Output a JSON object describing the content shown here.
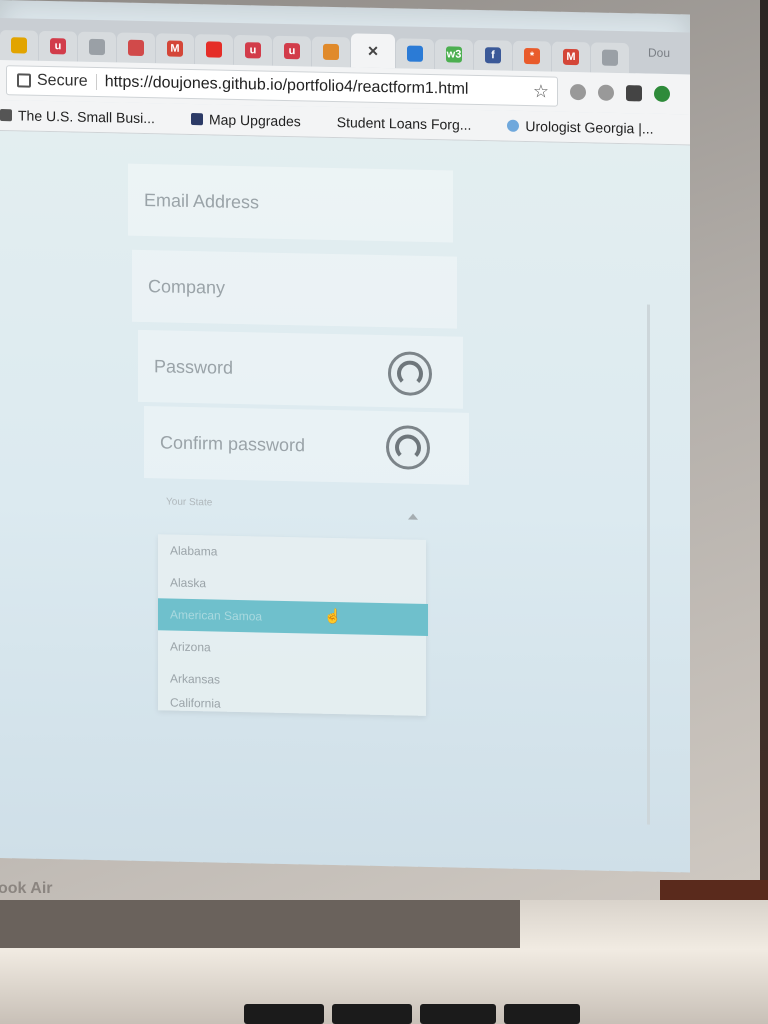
{
  "browser": {
    "tabs": [
      {
        "icon": "checkmark-favicon",
        "color": "#e2a400",
        "label": ""
      },
      {
        "icon": "u-favicon",
        "color": "#d23c4a",
        "label": "u"
      },
      {
        "icon": "document-favicon",
        "color": "#9aa0a6",
        "label": ""
      },
      {
        "icon": "photo-favicon",
        "color": "#d14a4a",
        "label": ""
      },
      {
        "icon": "gmail-favicon",
        "color": "#d44638",
        "label": "M"
      },
      {
        "icon": "youtube-favicon",
        "color": "#e52d27",
        "label": ""
      },
      {
        "icon": "u-favicon",
        "color": "#d23c4a",
        "label": "u"
      },
      {
        "icon": "u-favicon",
        "color": "#d23c4a",
        "label": "u"
      },
      {
        "icon": "book-favicon",
        "color": "#e08a2b",
        "label": ""
      },
      {
        "icon": "close-tab",
        "color": "#444",
        "label": "×"
      },
      {
        "icon": "bulb-favicon",
        "color": "#2b7bd6",
        "label": ""
      },
      {
        "icon": "w3-favicon",
        "color": "#4caf50",
        "label": "w3"
      },
      {
        "icon": "facebook-favicon",
        "color": "#3b5998",
        "label": "f"
      },
      {
        "icon": "asterisk-favicon",
        "color": "#e95b2b",
        "label": "*"
      },
      {
        "icon": "gmail-favicon",
        "color": "#d44638",
        "label": "M"
      },
      {
        "icon": "document-favicon",
        "color": "#9aa0a6",
        "label": ""
      }
    ],
    "user": "Dou",
    "secure_label": "Secure",
    "url": "https://doujones.github.io/portfolio4/reactform1.html",
    "bookmarks": [
      {
        "label": "The U.S. Small Busi..."
      },
      {
        "label": "Map Upgrades"
      },
      {
        "label": "Student Loans Forg..."
      },
      {
        "label": "Urologist Georgia |..."
      }
    ],
    "bookmarks_more": "»"
  },
  "form": {
    "email_placeholder": "Email Address",
    "company_placeholder": "Company",
    "password_placeholder": "Password",
    "confirm_placeholder": "Confirm password",
    "state_label": "Your State",
    "state_options": [
      "Alabama",
      "Alaska",
      "American Samoa",
      "Arizona",
      "Arkansas"
    ],
    "selected_option_index": 2,
    "partial_option": "California"
  },
  "device": {
    "brand_text": "ook Air"
  }
}
